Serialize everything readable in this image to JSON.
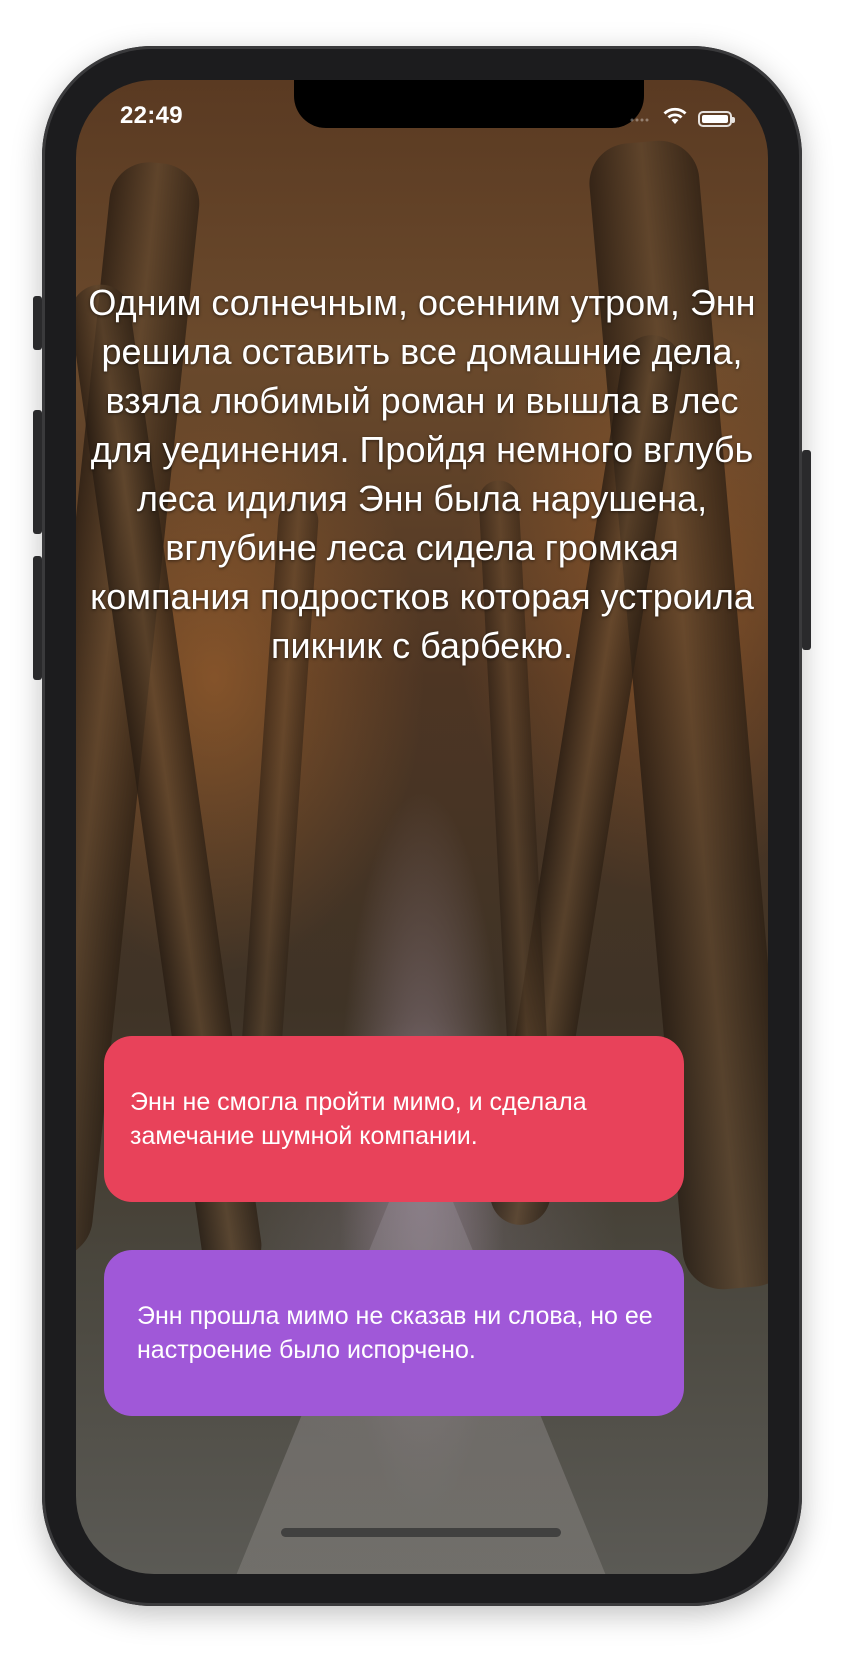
{
  "status_bar": {
    "time": "22:49"
  },
  "story": {
    "text": "Одним солнечным, осенним утром, Энн решила оставить все домашние дела, взяла любимый роман и вышла в лес для уединения. Пройдя немного вглубь леса идилия Энн была нарушена, вглубине леса сидела громкая компания подростков которая устроила пикник с барбекю."
  },
  "choices": [
    {
      "label": "Энн не смогла пройти мимо, и сделала замечание шумной компании.",
      "color": "#e8425a"
    },
    {
      "label": "Энн прошла мимо не сказав ни слова, но ее настроение было испорчено.",
      "color": "#a058d8"
    }
  ],
  "icons": {
    "signal": "cellular-signal-icon",
    "wifi": "wifi-icon",
    "battery": "battery-icon"
  }
}
